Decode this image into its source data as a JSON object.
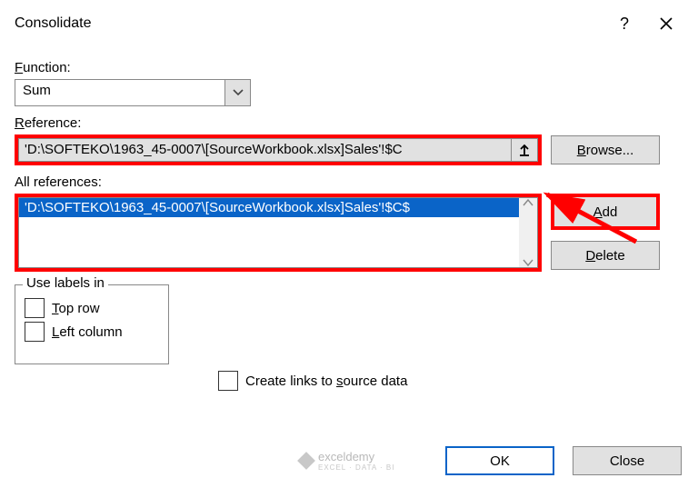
{
  "titlebar": {
    "title": "Consolidate"
  },
  "labels": {
    "function": "Function:",
    "reference": "Reference:",
    "all_references": "All references:",
    "use_labels_in": "Use labels in"
  },
  "function": {
    "value": "Sum"
  },
  "reference": {
    "value": "'D:\\SOFTEKO\\1963_45-0007\\[SourceWorkbook.xlsx]Sales'!$C"
  },
  "all_references": {
    "items": [
      "'D:\\SOFTEKO\\1963_45-0007\\[SourceWorkbook.xlsx]Sales'!$C$"
    ]
  },
  "buttons": {
    "browse": "Browse...",
    "add": "Add",
    "delete": "Delete",
    "ok": "OK",
    "close": "Close"
  },
  "checks": {
    "top_row": "Top row",
    "left_column": "Left column",
    "create_links": "Create links to source data"
  },
  "watermark": {
    "brand": "exceldemy",
    "sub": "EXCEL · DATA · BI"
  }
}
